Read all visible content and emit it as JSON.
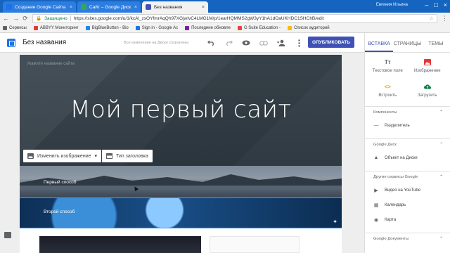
{
  "browser": {
    "tabs": [
      {
        "title": "Создание Google Сайта",
        "color": "#1a73e8"
      },
      {
        "title": "Сайт – Google Диск",
        "color": "#34a853"
      },
      {
        "title": "Без названия",
        "color": "#3f51b5"
      }
    ],
    "profile": "Евгения Ильина",
    "secure_label": "Защищено",
    "url": "https://sites.google.com/u/1/kcAl_zsOYfmrAqQh97XGjwIvC4LMG1M/p/1earHQMMS2gW3yY1hA1dOaUKHDC1SHChB/edit",
    "bookmarks": [
      {
        "label": "Сервисы",
        "color": "#5f6368"
      },
      {
        "label": "ABBYY Мониторинг",
        "color": "#e53935"
      },
      {
        "label": "BigBlueButton - Bio",
        "color": "#1e88e5"
      },
      {
        "label": "Sign in - Google Ac",
        "color": "#1a73e8"
      },
      {
        "label": "Последние обновле",
        "color": "#7b1fa2"
      },
      {
        "label": "G Suite Education -",
        "color": "#ea4335"
      },
      {
        "label": "Список аудиторий",
        "color": "#fbbc04"
      }
    ]
  },
  "editor": {
    "doc_title": "Без названия",
    "saved_status": "Все изменения на Диске сохранены",
    "publish_label": "ОПУБЛИКОВАТЬ"
  },
  "panel": {
    "tabs": [
      "ВСТАВКА",
      "СТРАНИЦЫ",
      "ТЕМЫ"
    ],
    "grid": [
      {
        "label": "Текстовое поле",
        "icon": "Tт",
        "color": "#5f6368"
      },
      {
        "label": "Изображение",
        "icon": "▲",
        "color": "#e53935"
      },
      {
        "label": "Встроить",
        "icon": "<>",
        "color": "#f4a300"
      },
      {
        "label": "Загрузить",
        "icon": "▲",
        "color": "#0b8043"
      }
    ],
    "sections": [
      {
        "title": "Компоненты",
        "items": [
          {
            "label": "Разделитель",
            "icon": "—"
          }
        ]
      },
      {
        "title": "Google Диск",
        "items": [
          {
            "label": "Объект на Диске",
            "icon": "▲"
          }
        ]
      },
      {
        "title": "Другие сервисы Google",
        "items": [
          {
            "label": "Видео на YouTube",
            "icon": "▶"
          },
          {
            "label": "Календарь",
            "icon": "▦"
          },
          {
            "label": "Карта",
            "icon": "◉"
          }
        ]
      },
      {
        "title": "Google Документы",
        "items": []
      }
    ]
  },
  "site": {
    "hero_hint": "Укажите название сайта",
    "hero_title": "Мой первый сайт",
    "change_image_label": "Изменить изображение",
    "header_type_label": "Тип заголовка",
    "section1_label": "Первый способ",
    "section2_label": "Второй способ"
  }
}
